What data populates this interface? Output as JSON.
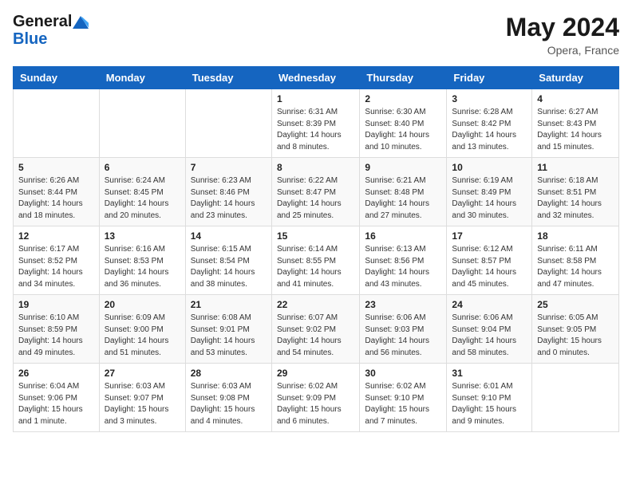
{
  "header": {
    "logo_line1": "General",
    "logo_line2": "Blue",
    "month_year": "May 2024",
    "location": "Opera, France"
  },
  "days_of_week": [
    "Sunday",
    "Monday",
    "Tuesday",
    "Wednesday",
    "Thursday",
    "Friday",
    "Saturday"
  ],
  "weeks": [
    [
      {
        "day": "",
        "info": ""
      },
      {
        "day": "",
        "info": ""
      },
      {
        "day": "",
        "info": ""
      },
      {
        "day": "1",
        "info": "Sunrise: 6:31 AM\nSunset: 8:39 PM\nDaylight: 14 hours\nand 8 minutes."
      },
      {
        "day": "2",
        "info": "Sunrise: 6:30 AM\nSunset: 8:40 PM\nDaylight: 14 hours\nand 10 minutes."
      },
      {
        "day": "3",
        "info": "Sunrise: 6:28 AM\nSunset: 8:42 PM\nDaylight: 14 hours\nand 13 minutes."
      },
      {
        "day": "4",
        "info": "Sunrise: 6:27 AM\nSunset: 8:43 PM\nDaylight: 14 hours\nand 15 minutes."
      }
    ],
    [
      {
        "day": "5",
        "info": "Sunrise: 6:26 AM\nSunset: 8:44 PM\nDaylight: 14 hours\nand 18 minutes."
      },
      {
        "day": "6",
        "info": "Sunrise: 6:24 AM\nSunset: 8:45 PM\nDaylight: 14 hours\nand 20 minutes."
      },
      {
        "day": "7",
        "info": "Sunrise: 6:23 AM\nSunset: 8:46 PM\nDaylight: 14 hours\nand 23 minutes."
      },
      {
        "day": "8",
        "info": "Sunrise: 6:22 AM\nSunset: 8:47 PM\nDaylight: 14 hours\nand 25 minutes."
      },
      {
        "day": "9",
        "info": "Sunrise: 6:21 AM\nSunset: 8:48 PM\nDaylight: 14 hours\nand 27 minutes."
      },
      {
        "day": "10",
        "info": "Sunrise: 6:19 AM\nSunset: 8:49 PM\nDaylight: 14 hours\nand 30 minutes."
      },
      {
        "day": "11",
        "info": "Sunrise: 6:18 AM\nSunset: 8:51 PM\nDaylight: 14 hours\nand 32 minutes."
      }
    ],
    [
      {
        "day": "12",
        "info": "Sunrise: 6:17 AM\nSunset: 8:52 PM\nDaylight: 14 hours\nand 34 minutes."
      },
      {
        "day": "13",
        "info": "Sunrise: 6:16 AM\nSunset: 8:53 PM\nDaylight: 14 hours\nand 36 minutes."
      },
      {
        "day": "14",
        "info": "Sunrise: 6:15 AM\nSunset: 8:54 PM\nDaylight: 14 hours\nand 38 minutes."
      },
      {
        "day": "15",
        "info": "Sunrise: 6:14 AM\nSunset: 8:55 PM\nDaylight: 14 hours\nand 41 minutes."
      },
      {
        "day": "16",
        "info": "Sunrise: 6:13 AM\nSunset: 8:56 PM\nDaylight: 14 hours\nand 43 minutes."
      },
      {
        "day": "17",
        "info": "Sunrise: 6:12 AM\nSunset: 8:57 PM\nDaylight: 14 hours\nand 45 minutes."
      },
      {
        "day": "18",
        "info": "Sunrise: 6:11 AM\nSunset: 8:58 PM\nDaylight: 14 hours\nand 47 minutes."
      }
    ],
    [
      {
        "day": "19",
        "info": "Sunrise: 6:10 AM\nSunset: 8:59 PM\nDaylight: 14 hours\nand 49 minutes."
      },
      {
        "day": "20",
        "info": "Sunrise: 6:09 AM\nSunset: 9:00 PM\nDaylight: 14 hours\nand 51 minutes."
      },
      {
        "day": "21",
        "info": "Sunrise: 6:08 AM\nSunset: 9:01 PM\nDaylight: 14 hours\nand 53 minutes."
      },
      {
        "day": "22",
        "info": "Sunrise: 6:07 AM\nSunset: 9:02 PM\nDaylight: 14 hours\nand 54 minutes."
      },
      {
        "day": "23",
        "info": "Sunrise: 6:06 AM\nSunset: 9:03 PM\nDaylight: 14 hours\nand 56 minutes."
      },
      {
        "day": "24",
        "info": "Sunrise: 6:06 AM\nSunset: 9:04 PM\nDaylight: 14 hours\nand 58 minutes."
      },
      {
        "day": "25",
        "info": "Sunrise: 6:05 AM\nSunset: 9:05 PM\nDaylight: 15 hours\nand 0 minutes."
      }
    ],
    [
      {
        "day": "26",
        "info": "Sunrise: 6:04 AM\nSunset: 9:06 PM\nDaylight: 15 hours\nand 1 minute."
      },
      {
        "day": "27",
        "info": "Sunrise: 6:03 AM\nSunset: 9:07 PM\nDaylight: 15 hours\nand 3 minutes."
      },
      {
        "day": "28",
        "info": "Sunrise: 6:03 AM\nSunset: 9:08 PM\nDaylight: 15 hours\nand 4 minutes."
      },
      {
        "day": "29",
        "info": "Sunrise: 6:02 AM\nSunset: 9:09 PM\nDaylight: 15 hours\nand 6 minutes."
      },
      {
        "day": "30",
        "info": "Sunrise: 6:02 AM\nSunset: 9:10 PM\nDaylight: 15 hours\nand 7 minutes."
      },
      {
        "day": "31",
        "info": "Sunrise: 6:01 AM\nSunset: 9:10 PM\nDaylight: 15 hours\nand 9 minutes."
      },
      {
        "day": "",
        "info": ""
      }
    ]
  ]
}
